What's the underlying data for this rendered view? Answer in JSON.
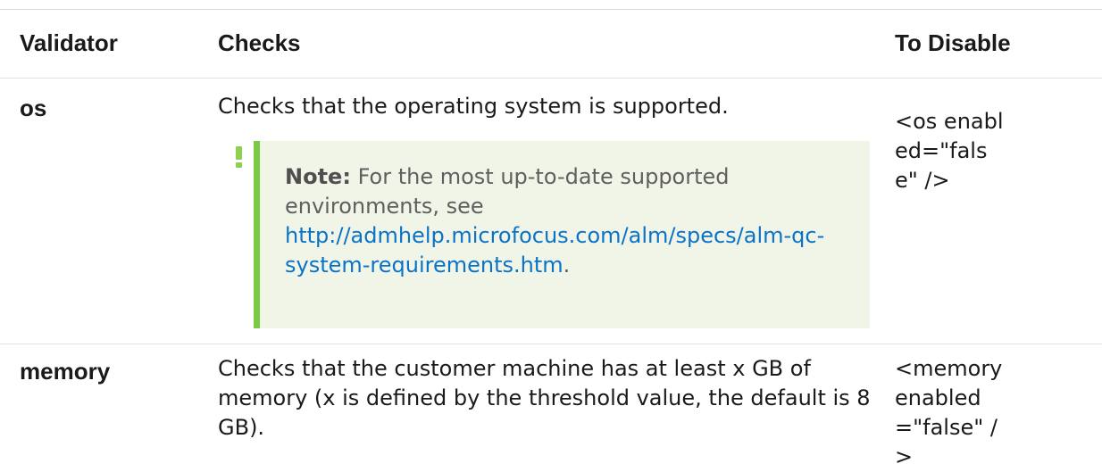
{
  "table": {
    "headers": {
      "validator": "Validator",
      "checks": "Checks",
      "to_disable": "To Disable"
    },
    "rows": [
      {
        "validator": "os",
        "checks": "Checks that the operating system is supported.",
        "note": {
          "label": "Note:",
          "text": "For the most up-to-date supported environments, see",
          "link_text": "http://admhelp.microfocus.com/alm/specs/alm-qc-system-requirements.htm",
          "trailing": "."
        },
        "to_disable": "<os enabled=\"false\" />"
      },
      {
        "validator": "memory",
        "checks": "Checks that the customer machine has at least x GB of memory (x is defined by the threshold value, the default is 8 GB).",
        "to_disable": "<memory enabled=\"false\" />"
      }
    ]
  },
  "colors": {
    "note_background": "#f1f5e8",
    "note_accent": "#7ac943",
    "link": "#0a73c8",
    "rule": "#e2e2e2"
  },
  "icons": {
    "note": "exclamation-icon"
  }
}
